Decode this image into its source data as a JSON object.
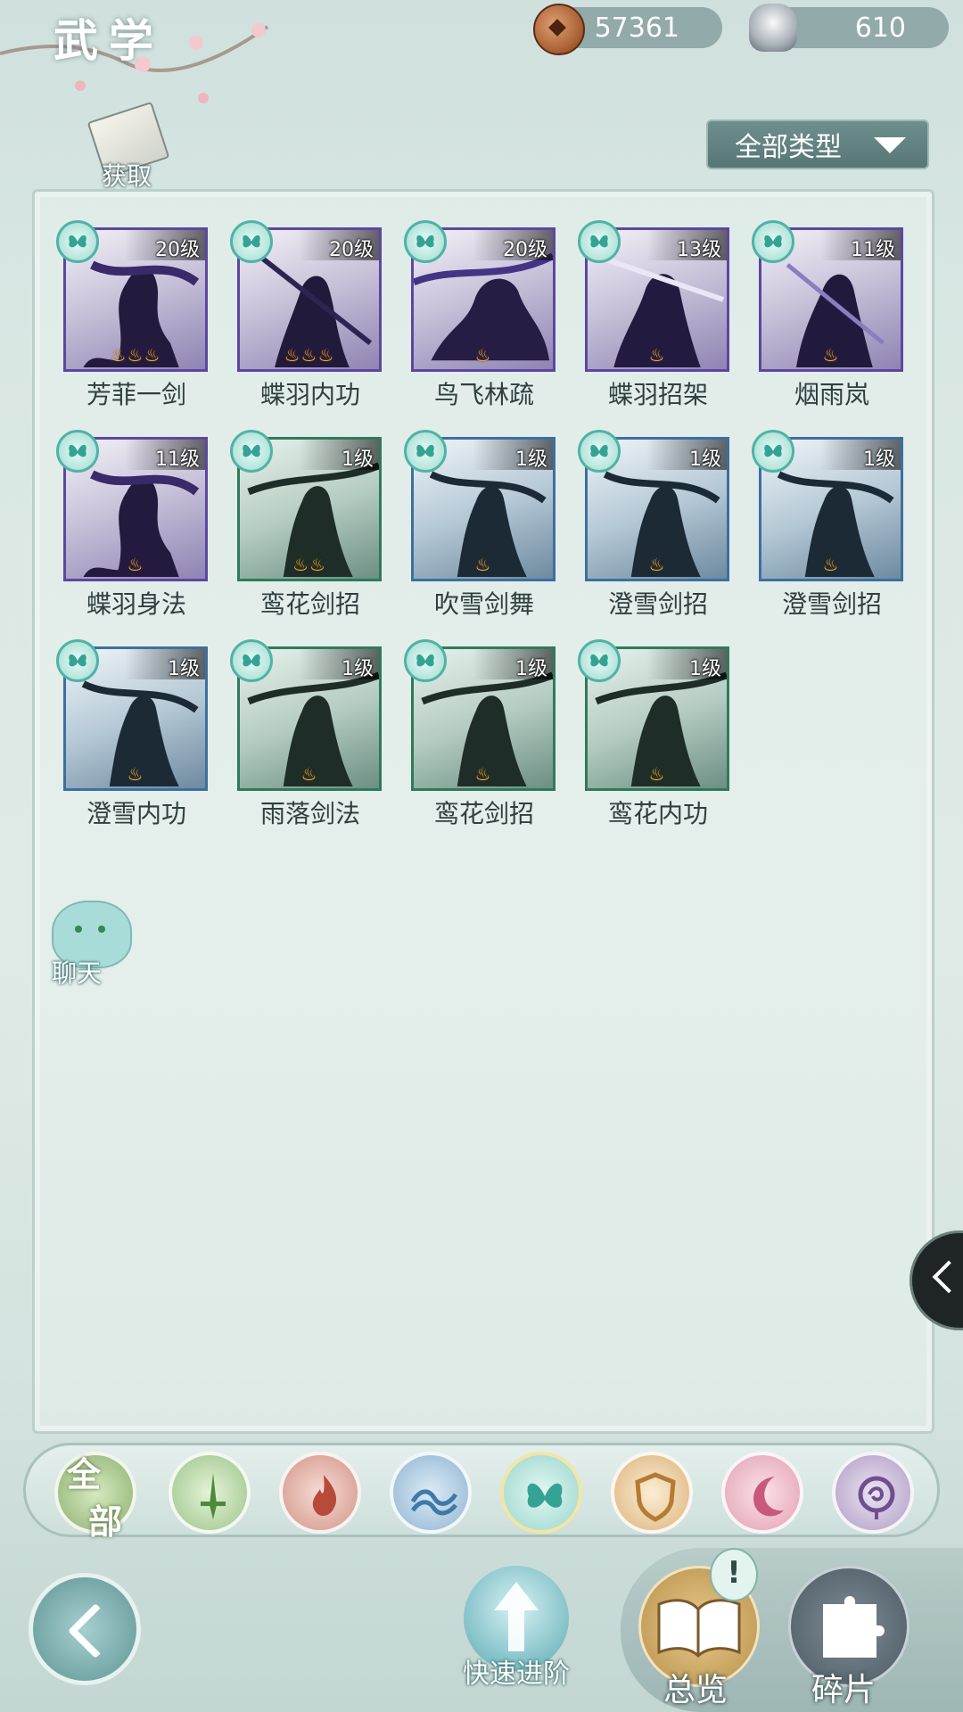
{
  "header": {
    "title": "武学",
    "copper": "57361",
    "silver": "610"
  },
  "get_button": {
    "label": "获取"
  },
  "filter": {
    "label": "全部类型"
  },
  "skills": [
    {
      "name": "芳菲一剑",
      "level": "20级",
      "rarity": "purple",
      "stars": 3
    },
    {
      "name": "蝶羽内功",
      "level": "20级",
      "rarity": "purple",
      "stars": 3
    },
    {
      "name": "鸟飞林疏",
      "level": "20级",
      "rarity": "purple",
      "stars": 1
    },
    {
      "name": "蝶羽招架",
      "level": "13级",
      "rarity": "purple",
      "stars": 1
    },
    {
      "name": "烟雨岚",
      "level": "11级",
      "rarity": "purple",
      "stars": 1
    },
    {
      "name": "蝶羽身法",
      "level": "11级",
      "rarity": "purple",
      "stars": 1
    },
    {
      "name": "鸾花剑招",
      "level": "1级",
      "rarity": "green",
      "stars": 2
    },
    {
      "name": "吹雪剑舞",
      "level": "1级",
      "rarity": "blue",
      "stars": 1
    },
    {
      "name": "澄雪剑招",
      "level": "1级",
      "rarity": "blue",
      "stars": 1
    },
    {
      "name": "澄雪剑招",
      "level": "1级",
      "rarity": "blue",
      "stars": 1
    },
    {
      "name": "澄雪内功",
      "level": "1级",
      "rarity": "blue",
      "stars": 1
    },
    {
      "name": "雨落剑法",
      "level": "1级",
      "rarity": "green",
      "stars": 1
    },
    {
      "name": "鸾花剑招",
      "level": "1级",
      "rarity": "green",
      "stars": 1
    },
    {
      "name": "鸾花内功",
      "level": "1级",
      "rarity": "green",
      "stars": 1
    }
  ],
  "chat": {
    "label": "聊天"
  },
  "categories": {
    "all_line1": "全",
    "all_line2": "部"
  },
  "bottom": {
    "quick_advance": "快速进阶",
    "overview": "总览",
    "fragments": "碎片",
    "alert": "!"
  }
}
